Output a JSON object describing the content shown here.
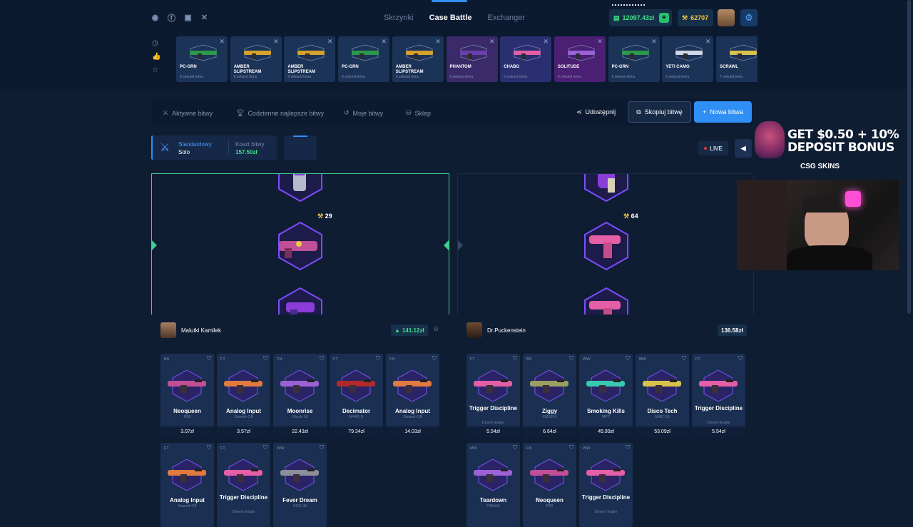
{
  "header": {
    "nav": [
      "Skrzynki",
      "Case Battle",
      "Exchanger"
    ],
    "active_nav": "Case Battle",
    "balance": "12097.43zł",
    "points": "62707",
    "social_icons": [
      "discord-icon",
      "facebook-icon",
      "instagram-icon",
      "x-icon"
    ]
  },
  "recent_drops": [
    {
      "name": "PC-GRN",
      "sub": "6 sekund temu",
      "color": "#1c3358"
    },
    {
      "name": "AMBER SLIPSTREAM",
      "sub": "6 sekund temu",
      "color": "#1c3358"
    },
    {
      "name": "AMBER SLIPSTREAM",
      "sub": "6 sekund temu",
      "color": "#1c3358"
    },
    {
      "name": "PC-GRN",
      "sub": "6 sekund temu",
      "color": "#1c3358"
    },
    {
      "name": "AMBER SLIPSTREAM",
      "sub": "6 sekund temu",
      "color": "#1c3358"
    },
    {
      "name": "PHANTOM",
      "sub": "6 sekund temu",
      "color": "#3b2a6a"
    },
    {
      "name": "CHABO",
      "sub": "6 sekund temu",
      "color": "#2a2f72"
    },
    {
      "name": "SOLITUDE",
      "sub": "6 sekund temu",
      "color": "#4a1f74"
    },
    {
      "name": "PC-GRN",
      "sub": "6 sekund temu",
      "color": "#1c3358"
    },
    {
      "name": "YETI CAMO",
      "sub": "6 sekund temu",
      "color": "#1c3358"
    },
    {
      "name": "SCRAWL",
      "sub": "7 sekund temu",
      "color": "#1c3358"
    }
  ],
  "tabs": {
    "active": "Aktywne bitwy",
    "daily": "Codzienne najlepsze bitwy",
    "mine": "Moje bitwy",
    "shop": "Sklep",
    "share": "Udostępnij",
    "copy": "Skopiuj bitwę",
    "new": "Nowa bitwa"
  },
  "battle": {
    "mode": "Standardowy",
    "type": "Solo",
    "cost_label": "Koszt bitwy",
    "cost": "157.50zł",
    "live": "LIVE"
  },
  "spinners": {
    "left_value": "29",
    "right_value": "64"
  },
  "players": [
    {
      "name": "Malutki Kamilek",
      "total": "141.12zł",
      "items": [
        {
          "cond": "BS",
          "name": "Neoqueen",
          "weapon": "P90",
          "price": "3.07zł"
        },
        {
          "cond": "FT",
          "name": "Analog Input",
          "weapon": "Sawed-Off",
          "price": "3.57zł"
        },
        {
          "cond": "FN",
          "name": "Moonrise",
          "weapon": "Glock-18",
          "price": "22.43zł"
        },
        {
          "cond": "FT",
          "name": "Decimator",
          "weapon": "M4A1-S",
          "price": "79.34zł"
        },
        {
          "cond": "FN",
          "name": "Analog Input",
          "weapon": "Sawed-Off",
          "price": "14.03zł"
        },
        {
          "cond": "FT",
          "name": "Analog Input",
          "weapon": "Sawed-Off",
          "price": ""
        },
        {
          "cond": "FT",
          "name": "Trigger Discipline",
          "weapon": "Desert Eagle",
          "price": ""
        },
        {
          "cond": "WW",
          "name": "Fever Dream",
          "weapon": "SSG 08",
          "price": ""
        }
      ]
    },
    {
      "name": "Dr.Puckenstein",
      "total": "136.58zł",
      "items": [
        {
          "cond": "FT",
          "name": "Trigger Discipline",
          "weapon": "Desert Eagle",
          "price": "5.54zł"
        },
        {
          "cond": "BS",
          "name": "Ziggy",
          "weapon": "XM1014",
          "price": "6.64zł"
        },
        {
          "cond": "WW",
          "name": "Smoking Kills",
          "weapon": "MP7",
          "price": "45.99zł"
        },
        {
          "cond": "MW",
          "name": "Disco Tech",
          "weapon": "MAC-10",
          "price": "53.09zł"
        },
        {
          "cond": "FT",
          "name": "Trigger Discipline",
          "weapon": "Desert Eagle",
          "price": "5.54zł"
        },
        {
          "cond": "MW",
          "name": "Teardown",
          "weapon": "FAMAS",
          "price": ""
        },
        {
          "cond": "FN",
          "name": "Neoqueen",
          "weapon": "P90",
          "price": ""
        },
        {
          "cond": "WW",
          "name": "Trigger Discipline",
          "weapon": "Desert Eagle",
          "price": ""
        }
      ]
    }
  ],
  "ad": {
    "line1": "GET $0.50 + 10%",
    "line2": "DEPOSIT BONUS",
    "brand": "CSG SKINS"
  }
}
